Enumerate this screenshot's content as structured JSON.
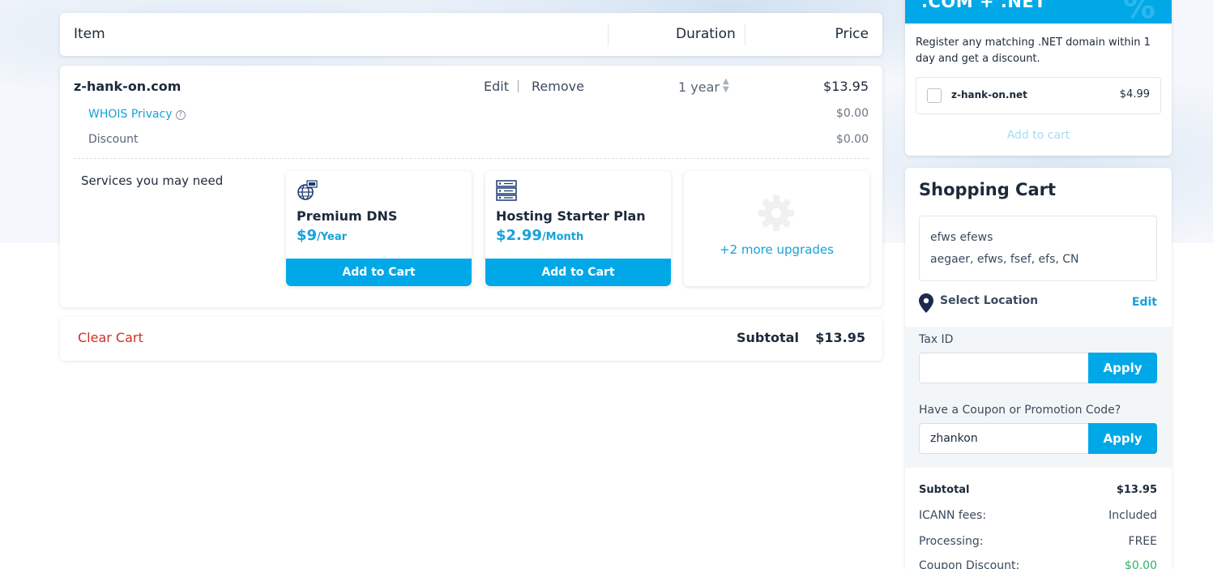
{
  "table_header": {
    "item": "Item",
    "duration": "Duration",
    "price": "Price"
  },
  "cart_item": {
    "domain": "z-hank-on.com",
    "edit": "Edit",
    "remove": "Remove",
    "duration": "1 year",
    "price": "$13.95",
    "whois_label": "WHOIS Privacy",
    "whois_price": "$0.00",
    "discount_label": "Discount",
    "discount_price": "$0.00"
  },
  "services": {
    "label": "Services you may need",
    "items": [
      {
        "title": "Premium DNS",
        "price": "$9",
        "unit": "/Year",
        "button": "Add to Cart",
        "icon": "dns-globe-icon"
      },
      {
        "title": "Hosting Starter Plan",
        "price": "$2.99",
        "unit": "/Month",
        "button": "Add to Cart",
        "icon": "server-icon"
      }
    ],
    "more": "+2 more upgrades"
  },
  "bottom_bar": {
    "clear_cart": "Clear Cart",
    "subtotal_label": "Subtotal",
    "subtotal_value": "$13.95"
  },
  "promo": {
    "banner": ".COM + .NET",
    "description": "Register any matching .NET domain within 1 day and get a discount.",
    "domain": "z-hank-on.net",
    "price": "$4.99",
    "add_to_cart": "Add to cart"
  },
  "shopping_cart": {
    "title": "Shopping Cart",
    "address_line1": "efws efews",
    "address_line2": "aegaer, efws, fsef, efs, CN",
    "select_location": "Select Location",
    "edit": "Edit",
    "tax_label": "Tax ID",
    "tax_value": "",
    "coupon_label": "Have a Coupon or Promotion Code?",
    "coupon_value": "zhankon",
    "apply": "Apply",
    "summary": {
      "subtotal_label": "Subtotal",
      "subtotal_value": "$13.95",
      "icann_label": "ICANN fees:",
      "icann_value": "Included",
      "processing_label": "Processing:",
      "processing_value": "FREE",
      "coupon_label": "Coupon Discount:",
      "coupon_value": "$0.00"
    }
  },
  "colors": {
    "accent": "#00a8e8",
    "link": "#17a2d8",
    "danger": "#cf2f23",
    "success": "#2fb36b"
  }
}
